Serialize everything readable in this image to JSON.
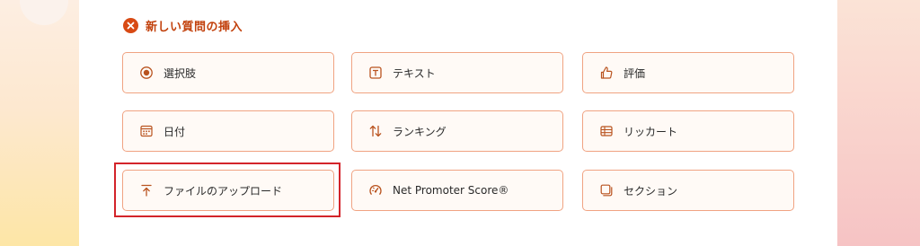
{
  "header": {
    "title": "新しい質問の挿入",
    "close_icon": "close-circle-icon",
    "accent_color": "#d84a14"
  },
  "question_types": [
    {
      "label": "選択肢",
      "icon": "radio-button-icon"
    },
    {
      "label": "テキスト",
      "icon": "text-box-icon"
    },
    {
      "label": "評価",
      "icon": "thumbs-up-icon"
    },
    {
      "label": "日付",
      "icon": "calendar-icon"
    },
    {
      "label": "ランキング",
      "icon": "sort-arrows-icon"
    },
    {
      "label": "リッカート",
      "icon": "likert-grid-icon"
    },
    {
      "label": "ファイルのアップロード",
      "icon": "upload-icon"
    },
    {
      "label": "Net Promoter Score®",
      "icon": "gauge-icon"
    },
    {
      "label": "セクション",
      "icon": "section-icon"
    }
  ],
  "colors": {
    "button_border": "#f0a382",
    "button_bg": "#fffaf6",
    "highlight_border": "#d3242a"
  }
}
